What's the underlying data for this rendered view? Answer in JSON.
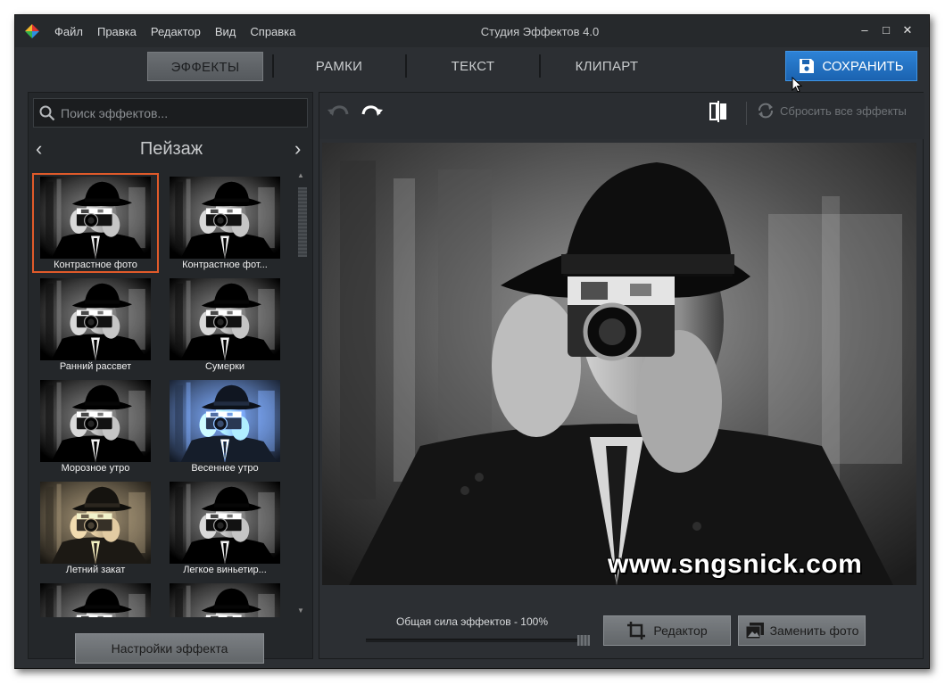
{
  "app": {
    "title": "Студия Эффектов 4.0",
    "menu": [
      "Файл",
      "Правка",
      "Редактор",
      "Вид",
      "Справка"
    ],
    "window_controls": {
      "minimize": "–",
      "maximize": "□",
      "close": "✕"
    }
  },
  "tabs": [
    {
      "label": "ЭФФЕКТЫ",
      "active": true
    },
    {
      "label": "РАМКИ",
      "active": false
    },
    {
      "label": "ТЕКСТ",
      "active": false
    },
    {
      "label": "КЛИПАРТ",
      "active": false
    }
  ],
  "save_button": {
    "label": "СОХРАНИТЬ",
    "icon": "save-icon"
  },
  "effects_panel": {
    "search_placeholder": "Поиск эффектов...",
    "category": "Пейзаж",
    "prev_arrow": "‹",
    "next_arrow": "›",
    "effects": [
      {
        "label": "Контрастное фото",
        "tint": "bw",
        "selected": true
      },
      {
        "label": "Контрастное фот...",
        "tint": "bw",
        "selected": false
      },
      {
        "label": "Ранний рассвет",
        "tint": "bw",
        "selected": false
      },
      {
        "label": "Сумерки",
        "tint": "bw",
        "selected": false
      },
      {
        "label": "Морозное утро",
        "tint": "bw",
        "selected": false
      },
      {
        "label": "Весеннее утро",
        "tint": "blue",
        "selected": false
      },
      {
        "label": "Летний закат",
        "tint": "sepia",
        "selected": false
      },
      {
        "label": "Легкое виньетир...",
        "tint": "bw",
        "selected": false
      },
      {
        "label": "",
        "tint": "bw",
        "selected": false
      },
      {
        "label": "",
        "tint": "bw",
        "selected": false
      }
    ],
    "settings_button": "Настройки эффекта"
  },
  "toolbar": {
    "reset_label": "Сбросить все эффекты"
  },
  "preview": {
    "watermark": "www.sngsnick.com"
  },
  "bottom": {
    "strength_label": "Общая сила эффектов - 100%",
    "strength_value": 1.0,
    "editor_button": "Редактор",
    "replace_button": "Заменить фото"
  },
  "colors": {
    "accent_blue": "#1f6fc3",
    "selected_border": "#e05a2a",
    "background": "#2c2f33"
  }
}
